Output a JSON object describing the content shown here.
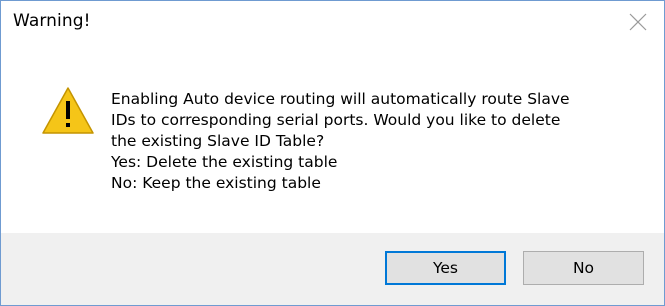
{
  "dialog": {
    "title": "Warning!",
    "icon": "warning-icon",
    "message_lines": [
      "Enabling Auto device routing will automatically route Slave",
      "IDs to corresponding serial ports. Would you like to delete",
      "the existing Slave ID Table?",
      "Yes: Delete the existing table",
      "No: Keep the existing table"
    ],
    "yes_label": "Yes",
    "no_label": "No"
  },
  "colors": {
    "accent": "#0078d7",
    "warning": "#f5c518",
    "footer_bg": "#f0f0f0"
  }
}
